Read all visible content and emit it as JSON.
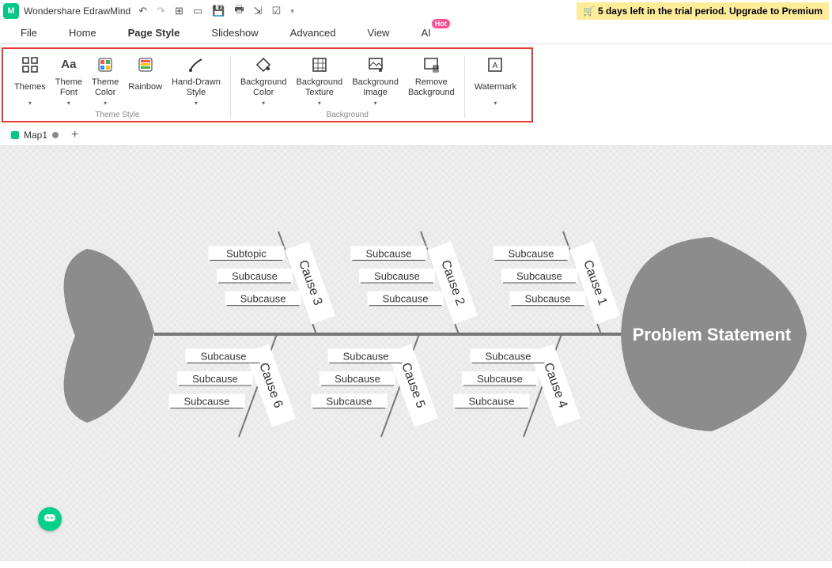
{
  "title": "Wondershare EdrawMind",
  "trial_text": "5 days left in the trial period. Upgrade to Premium",
  "menu": {
    "items": [
      "File",
      "Home",
      "Page Style",
      "Slideshow",
      "Advanced",
      "View",
      "AI"
    ],
    "active": "Page Style",
    "ai_badge": "Hot"
  },
  "ribbon": {
    "groups": [
      {
        "label": "Theme Style",
        "buttons": [
          {
            "name": "themes",
            "label": "Themes",
            "dropdown": true
          },
          {
            "name": "theme-font",
            "label": "Theme\nFont",
            "dropdown": true
          },
          {
            "name": "theme-color",
            "label": "Theme\nColor",
            "dropdown": true
          },
          {
            "name": "rainbow",
            "label": "Rainbow",
            "dropdown": false
          },
          {
            "name": "hand-drawn",
            "label": "Hand-Drawn\nStyle",
            "dropdown": true
          }
        ]
      },
      {
        "label": "Background",
        "buttons": [
          {
            "name": "bg-color",
            "label": "Background\nColor",
            "dropdown": true
          },
          {
            "name": "bg-texture",
            "label": "Background\nTexture",
            "dropdown": true
          },
          {
            "name": "bg-image",
            "label": "Background\nImage",
            "dropdown": true
          },
          {
            "name": "remove-bg",
            "label": "Remove\nBackground",
            "dropdown": false
          }
        ]
      },
      {
        "label": "",
        "buttons": [
          {
            "name": "watermark",
            "label": "Watermark",
            "dropdown": true
          }
        ]
      }
    ]
  },
  "doctab": {
    "name": "Map1"
  },
  "fishbone": {
    "head": "Problem Statement",
    "top_causes": [
      {
        "title": "Cause 3",
        "subs": [
          "Subcause",
          "Subcause",
          "Subtopic"
        ]
      },
      {
        "title": "Cause 2",
        "subs": [
          "Subcause",
          "Subcause",
          "Subcause"
        ]
      },
      {
        "title": "Cause 1",
        "subs": [
          "Subcause",
          "Subcause",
          "Subcause"
        ]
      }
    ],
    "bottom_causes": [
      {
        "title": "Cause 6",
        "subs": [
          "Subcause",
          "Subcause",
          "Subcause"
        ]
      },
      {
        "title": "Cause 5",
        "subs": [
          "Subcause",
          "Subcause",
          "Subcause"
        ]
      },
      {
        "title": "Cause 4",
        "subs": [
          "Subcause",
          "Subcause",
          "Subcause"
        ]
      }
    ]
  }
}
